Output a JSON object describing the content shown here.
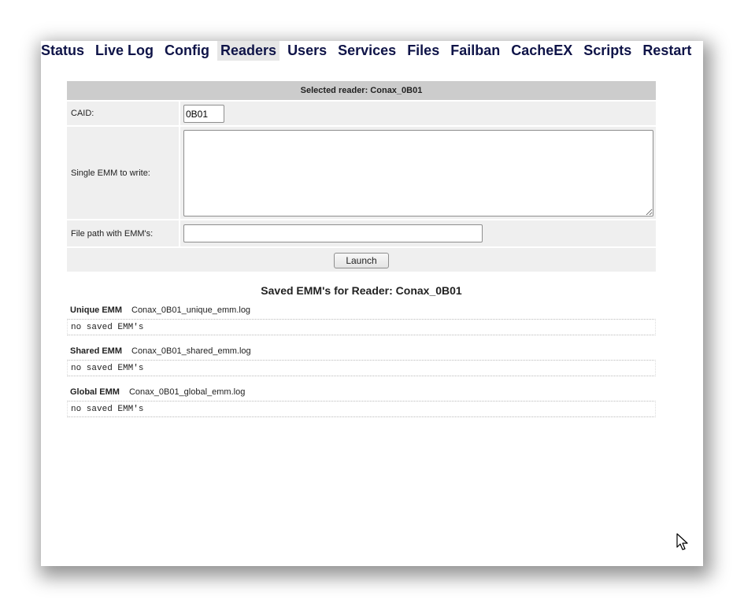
{
  "nav": {
    "items": [
      "Status",
      "Live Log",
      "Config",
      "Readers",
      "Users",
      "Services",
      "Files",
      "Failban",
      "CacheEX",
      "Scripts",
      "Restart"
    ],
    "active": "Readers"
  },
  "form": {
    "header": "Selected reader: Conax_0B01",
    "caid_label": "CAID:",
    "caid_value": "0B01",
    "emm_label": "Single EMM to write:",
    "emm_value": "",
    "path_label": "File path with EMM's:",
    "path_value": "",
    "launch_label": "Launch"
  },
  "saved": {
    "title": "Saved EMM's for Reader: Conax_0B01",
    "sections": [
      {
        "label": "Unique EMM",
        "file": "Conax_0B01_unique_emm.log",
        "content": "no saved EMM's"
      },
      {
        "label": "Shared EMM",
        "file": "Conax_0B01_shared_emm.log",
        "content": "no saved EMM's"
      },
      {
        "label": "Global EMM",
        "file": "Conax_0B01_global_emm.log",
        "content": "no saved EMM's"
      }
    ]
  },
  "icons": {
    "cursor": "mouse-pointer-icon"
  }
}
